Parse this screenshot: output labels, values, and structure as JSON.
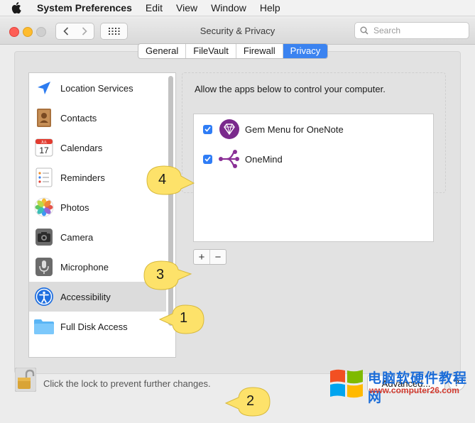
{
  "menubar": {
    "items": [
      "System Preferences",
      "Edit",
      "View",
      "Window",
      "Help"
    ]
  },
  "window": {
    "title": "Security & Privacy",
    "search_placeholder": "Search"
  },
  "tabs": [
    "General",
    "FileVault",
    "Firewall",
    "Privacy"
  ],
  "active_tab": "Privacy",
  "categories": [
    {
      "label": "Location Services",
      "icon": "location-arrow-icon"
    },
    {
      "label": "Contacts",
      "icon": "contacts-book-icon"
    },
    {
      "label": "Calendars",
      "icon": "calendar-icon"
    },
    {
      "label": "Reminders",
      "icon": "reminders-list-icon"
    },
    {
      "label": "Photos",
      "icon": "photos-flower-icon"
    },
    {
      "label": "Camera",
      "icon": "camera-icon"
    },
    {
      "label": "Microphone",
      "icon": "microphone-icon"
    },
    {
      "label": "Accessibility",
      "icon": "accessibility-icon"
    },
    {
      "label": "Full Disk Access",
      "icon": "folder-icon"
    }
  ],
  "calendar_icon": {
    "month": "JUL",
    "day": "17"
  },
  "selected_category": "Accessibility",
  "main": {
    "description": "Allow the apps below to control your computer.",
    "apps": [
      {
        "name": "Gem Menu for OneNote",
        "checked": true,
        "icon": "gem-icon"
      },
      {
        "name": "OneMind",
        "checked": true,
        "icon": "mindmap-icon"
      }
    ],
    "add_label": "+",
    "remove_label": "−"
  },
  "footer": {
    "lock_text": "Click the lock to prevent further changes.",
    "advanced_label": "Advanced...",
    "help_label": "?"
  },
  "callouts": [
    "1",
    "2",
    "3",
    "4"
  ],
  "watermark": {
    "title": "电脑软硬件教程网",
    "url": "www.computer26.com"
  },
  "colors": {
    "accent": "#3b83f0",
    "callout": "#fde26a",
    "checkbox": "#2f7df6"
  }
}
